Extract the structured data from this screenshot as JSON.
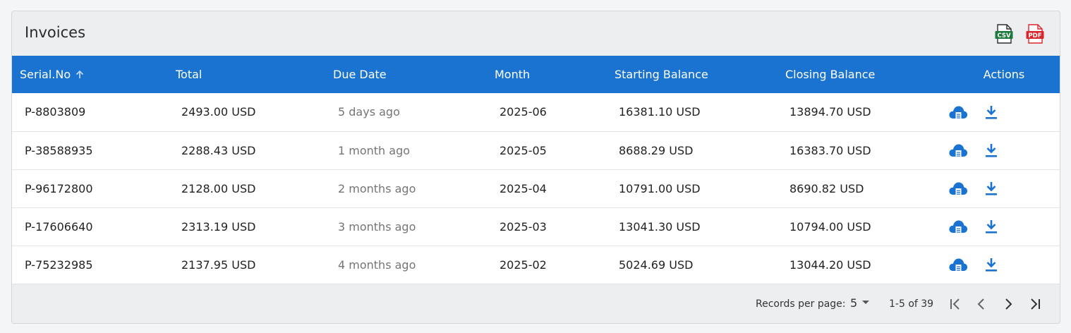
{
  "header": {
    "title": "Invoices",
    "export_csv_label": "CSV",
    "export_pdf_label": "PDF"
  },
  "columns": [
    "Serial.No",
    "Total",
    "Due Date",
    "Month",
    "Starting Balance",
    "Closing Balance",
    "Actions"
  ],
  "rows": [
    {
      "serial": "P-8803809",
      "total": "2493.00 USD",
      "due": "5 days ago",
      "month": "2025-06",
      "start": "16381.10 USD",
      "close": "13894.70 USD"
    },
    {
      "serial": "P-38588935",
      "total": "2288.43 USD",
      "due": "1 month ago",
      "month": "2025-05",
      "start": "8688.29 USD",
      "close": "16383.70 USD"
    },
    {
      "serial": "P-96172800",
      "total": "2128.00 USD",
      "due": "2 months ago",
      "month": "2025-04",
      "start": "10791.00 USD",
      "close": "8690.82 USD"
    },
    {
      "serial": "P-17606640",
      "total": "2313.19 USD",
      "due": "3 months ago",
      "month": "2025-03",
      "start": "13041.30 USD",
      "close": "10794.00 USD"
    },
    {
      "serial": "P-75232985",
      "total": "2137.95 USD",
      "due": "4 months ago",
      "month": "2025-02",
      "start": "5024.69 USD",
      "close": "13044.20 USD"
    }
  ],
  "footer": {
    "records_per_page_label": "Records per page:",
    "records_per_page_value": "5",
    "range_text": "1-5 of 39"
  },
  "icons": {
    "sort": "arrow-up-icon",
    "view": "cloud-document-icon",
    "download": "download-icon"
  },
  "colors": {
    "header_bg": "#1a73d0",
    "csv_green": "#1e7a3c",
    "pdf_red": "#d9262c",
    "action_blue": "#1a73d0"
  }
}
